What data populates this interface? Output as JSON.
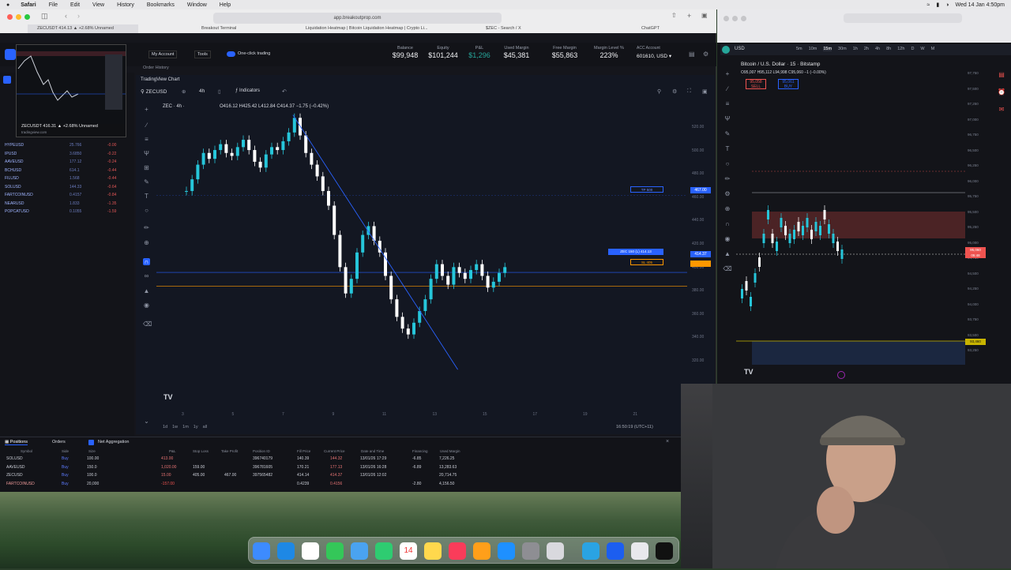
{
  "menubar": {
    "app": "Safari",
    "items": [
      "File",
      "Edit",
      "View",
      "History",
      "Bookmarks",
      "Window",
      "Help"
    ],
    "datetime": "Wed 14 Jan 4:50pm"
  },
  "browser": {
    "url": "app.breakoutprop.com",
    "tabs": [
      "ZECUSDT 414.13 ▲ +2.68% Unnamed",
      "Breakout Terminal",
      "Liquidation Heatmap | Bitcoin Liquidation Heatmap | Crypto Li...",
      "$ZEC - Search / X",
      "ChatGPT"
    ],
    "thumb_caption": "ZECUSDT 416.31 ▲ +2.68% Unnamed",
    "thumb_sub": "tradingview.com"
  },
  "header": {
    "account_btn": "My Account",
    "tools_btn": "Tools",
    "one_click": "One-click trading",
    "order_history": "Order History",
    "metrics": [
      {
        "label": "Balance",
        "value": "$99,948"
      },
      {
        "label": "Equity",
        "value": "$101,244"
      },
      {
        "label": "P&L",
        "value": "$1,296"
      },
      {
        "label": "Used Margin",
        "value": "$45,381"
      },
      {
        "label": "Free Margin",
        "value": "$55,863"
      },
      {
        "label": "Margin Level %",
        "value": "223%"
      }
    ],
    "account_label": "ACC  Account",
    "account_id": "601610, USD ▾"
  },
  "watchlist": [
    {
      "symbol": "HYPEUSD",
      "price": "25.766",
      "change": "-0.00"
    },
    {
      "symbol": "IPUSD",
      "price": "3.6850",
      "change": "-0.22"
    },
    {
      "symbol": "AAVEUSD",
      "price": "177.12",
      "change": "-0.24"
    },
    {
      "symbol": "BCHUSD",
      "price": "614.1",
      "change": "-0.44"
    },
    {
      "symbol": "FILUSD",
      "price": "1.568",
      "change": "-0.44"
    },
    {
      "symbol": "SOLUSD",
      "price": "144.33",
      "change": "-0.64"
    },
    {
      "symbol": "FARTCOINUSD",
      "price": "0.4157",
      "change": "-0.84"
    },
    {
      "symbol": "NEARUSD",
      "price": "1.833",
      "change": "-1.35"
    },
    {
      "symbol": "POPCATUSD",
      "price": "0.1055",
      "change": "-1.59"
    }
  ],
  "chart": {
    "panel_title": "TradingView Chart",
    "symbol": "ZECUSD",
    "interval": "4h",
    "indicators_btn": "Indicators",
    "legend": "ZEC · 4h ·",
    "ohlc": "O416.12 H425.42 L412.84 C414.37 −1.75 (−0.42%)",
    "y_ticks": [
      "520.00",
      "500.00",
      "480.00",
      "460.00",
      "440.00",
      "420.00",
      "400.00",
      "380.00",
      "360.00",
      "340.00",
      "320.00"
    ],
    "x_ticks": [
      "3",
      "5",
      "7",
      "9",
      "11",
      "13",
      "15",
      "17",
      "19",
      "21"
    ],
    "price_tag": "467.00",
    "current_price": "414.37",
    "tp_label": "TP 500",
    "entry_label": "ZEC 150 (L) 414.13",
    "sl_label": "SL 405",
    "time_ranges": [
      "1d",
      "1w",
      "1m",
      "1y",
      "all"
    ],
    "clock": "16:50:19 (UTC+11)"
  },
  "bottom": {
    "tabs": [
      "Positions",
      "Orders"
    ],
    "net_agg": "Net Aggregation",
    "columns": [
      "Symbol",
      "Side",
      "Size",
      "P&L",
      "Stop Loss",
      "Take Profit",
      "Position ID",
      "Fill Price",
      "Current Price",
      "Date and Time",
      "Financing",
      "Used Margin"
    ],
    "rows": [
      {
        "symbol": "SOLUSD",
        "side": "Buy",
        "size": "100.00",
        "pnl": "413.00",
        "sl": "",
        "tp": "",
        "id": "396740179",
        "fill": "140.39",
        "cur": "144.32",
        "date": "13/01/26 17:29",
        "fin": "-6.85",
        "margin": "7,226.25"
      },
      {
        "symbol": "AAVEUSD",
        "side": "Buy",
        "size": "150.0",
        "pnl": "1,020.00",
        "sl": "159.00",
        "tp": "",
        "id": "396781605",
        "fill": "170.21",
        "cur": "177.13",
        "date": "13/01/26 16:28",
        "fin": "-6.89",
        "margin": "13,283.63"
      },
      {
        "symbol": "ZECUSD",
        "side": "Buy",
        "size": "100.0",
        "pnl": "15.00",
        "sl": "405.00",
        "tp": "467.00",
        "id": "397565482",
        "fill": "414.14",
        "cur": "414.37",
        "date": "13/01/26 12:02",
        "fin": "",
        "margin": "20,714.75"
      },
      {
        "symbol": "FARTCOINUSD",
        "side": "Buy",
        "size": "20,000",
        "pnl": "-157.00",
        "sl": "",
        "tp": "",
        "id": "",
        "fill": "0.4239",
        "cur": "0.4156",
        "date": "",
        "fin": "-2.80",
        "margin": "4,156.50"
      }
    ]
  },
  "right_chart": {
    "tab": "Bitcoin / U.S. Dollar · 15 · Bitstamp",
    "ohlc": "O95,007 H95,112 L94,998 C95,060 −1 (−0.00%)",
    "sell": "95,058",
    "buy": "95,061",
    "symbol": "USD",
    "intervals": [
      "5m",
      "10m",
      "15m",
      "30m",
      "1h",
      "2h",
      "4h",
      "8h",
      "12h",
      "D",
      "W",
      "M"
    ],
    "y_ticks": [
      "97,750",
      "97,500",
      "97,250",
      "97,000",
      "96,750",
      "96,500",
      "96,250",
      "96,000",
      "95,750",
      "95,500",
      "95,250",
      "95,000",
      "94,750",
      "94,500",
      "94,250",
      "94,000",
      "93,750",
      "93,500",
      "93,250"
    ],
    "tag_price": "95,060",
    "tag_low": "93,460"
  },
  "colors": {
    "bull": "#26c6da",
    "bear": "#ffffff",
    "accent": "#2962ff",
    "tp": "#2962ff",
    "sl": "#ff9800",
    "loss": "#ef5350",
    "gain": "#26a69a"
  }
}
